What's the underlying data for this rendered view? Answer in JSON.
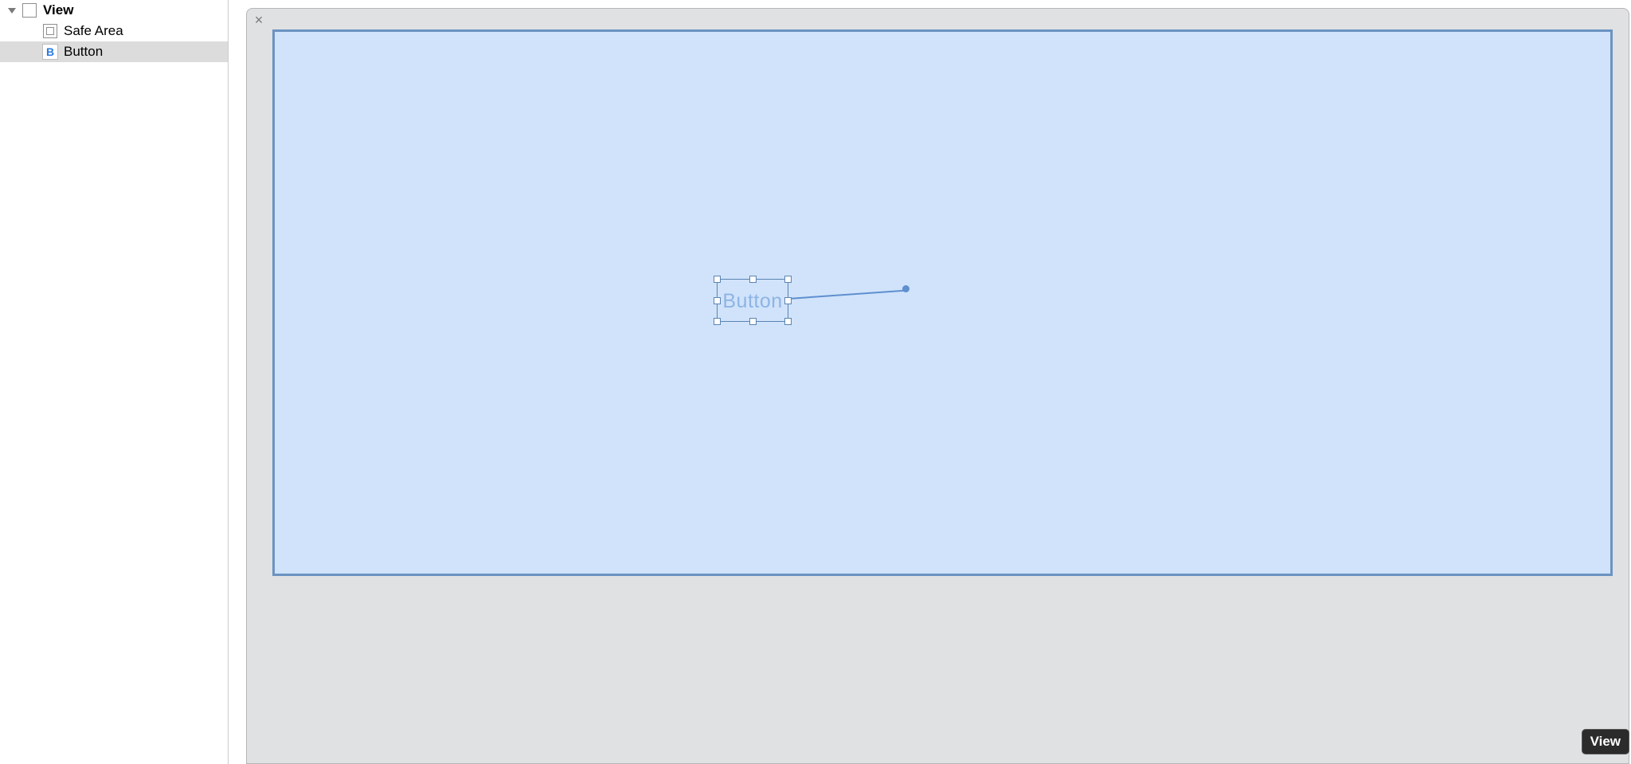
{
  "outline": {
    "root": {
      "label": "View"
    },
    "children": [
      {
        "label": "Safe Area"
      },
      {
        "label": "Button"
      }
    ]
  },
  "canvas": {
    "button_label": "Button",
    "close_glyph": "×"
  },
  "hud": {
    "hover_label": "View"
  },
  "icons": {
    "button_letter": "B"
  }
}
